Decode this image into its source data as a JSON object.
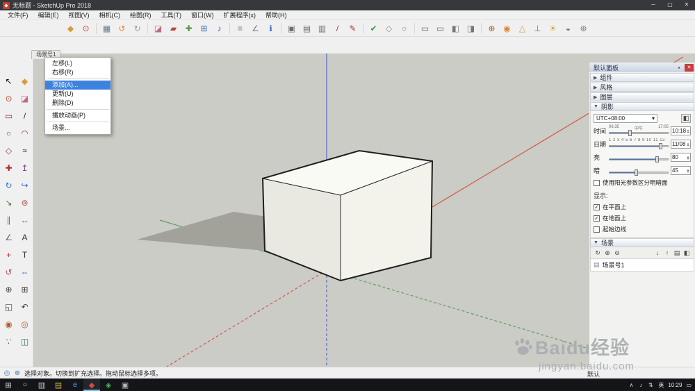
{
  "glyphs": {
    "logo": "◆",
    "minimize": "─",
    "maximize": "▢",
    "close": "✕",
    "pin": "▪",
    "panel_close": "✕",
    "caret_down": "▾",
    "spin_up": "▲",
    "spin_down": "▼",
    "check": "✓",
    "toggle_shadows": "◧"
  },
  "colors": {
    "accent": "#3e82e0",
    "axis_red": "#cf5a4c",
    "axis_green": "#5f9e5f",
    "axis_blue": "#5c64c8",
    "viewport_bg": "#cbccc5",
    "ground_shadow": "#a2a29a",
    "box_top": "#fafaf5",
    "box_left": "#e9e9e1",
    "box_right": "#f3f3ec",
    "edge": "#2a2a2a"
  },
  "title_bar": {
    "title": "无标题 - SketchUp Pro 2018"
  },
  "menu_bar": {
    "items": [
      {
        "name": "menu-file",
        "label": "文件(F)"
      },
      {
        "name": "menu-edit",
        "label": "编辑(E)"
      },
      {
        "name": "menu-view",
        "label": "视图(V)"
      },
      {
        "name": "menu-camera",
        "label": "相机(C)"
      },
      {
        "name": "menu-draw",
        "label": "绘图(R)"
      },
      {
        "name": "menu-tools",
        "label": "工具(T)"
      },
      {
        "name": "menu-window",
        "label": "窗口(W)"
      },
      {
        "name": "menu-extensions",
        "label": "扩展程序(x)"
      },
      {
        "name": "menu-help",
        "label": "帮助(H)"
      }
    ]
  },
  "main_toolbar": {
    "icons": [
      {
        "name": "make-component-icon",
        "glyph": "◆",
        "color": "#d89a3a"
      },
      {
        "name": "paint-bucket-icon",
        "glyph": "⊙",
        "color": "#bf4a35"
      },
      {
        "divider": true
      },
      {
        "name": "print-icon",
        "glyph": "▦",
        "color": "#6a7b8e"
      },
      {
        "name": "undo-icon",
        "glyph": "↺",
        "color": "#e0842f"
      },
      {
        "name": "redo-icon",
        "glyph": "↻",
        "color": "#9aa1a8"
      },
      {
        "divider": true
      },
      {
        "name": "eraser-icon",
        "glyph": "◪",
        "color": "#c06a88"
      },
      {
        "name": "paint-icon",
        "glyph": "▰",
        "color": "#b5483c"
      },
      {
        "name": "plant-component-icon",
        "glyph": "✚",
        "color": "#4f9a48"
      },
      {
        "name": "photo-texture-icon",
        "glyph": "⊞",
        "color": "#3c6fb3"
      },
      {
        "name": "audio-icon",
        "glyph": "♪",
        "color": "#2f6fd0"
      },
      {
        "divider": true
      },
      {
        "name": "tape-measure-icon",
        "glyph": "≡",
        "color": "#7d7d7d"
      },
      {
        "name": "dimension-icon",
        "glyph": "∠",
        "color": "#7d7d7d"
      },
      {
        "name": "model-info-icon",
        "glyph": "ℹ",
        "color": "#2f6fd0"
      },
      {
        "divider": true
      },
      {
        "name": "box-tool-icon-1",
        "glyph": "▣",
        "color": "#6e6e6e"
      },
      {
        "name": "box-tool-icon-2",
        "glyph": "▤",
        "color": "#6e6e6e"
      },
      {
        "name": "box-tool-icon-3",
        "glyph": "▥",
        "color": "#6e6e6e"
      },
      {
        "name": "slash-tool-icon",
        "glyph": "/",
        "color": "#b03434"
      },
      {
        "name": "pencil-tool-icon",
        "glyph": "✎",
        "color": "#b03434"
      },
      {
        "divider": true
      },
      {
        "name": "validate-check-icon",
        "glyph": "✔",
        "color": "#2f9e49"
      },
      {
        "name": "solid-tool-icon-1",
        "glyph": "◇",
        "color": "#8a8a8a"
      },
      {
        "name": "solid-tool-icon-2",
        "glyph": "○",
        "color": "#8a8a8a"
      },
      {
        "divider": true
      },
      {
        "name": "view-icon-1",
        "glyph": "▭",
        "color": "#5b6b7b"
      },
      {
        "name": "view-icon-2",
        "glyph": "▭",
        "color": "#5b6b7b"
      },
      {
        "name": "style-icon-1",
        "glyph": "◧",
        "color": "#777777"
      },
      {
        "name": "style-icon-2",
        "glyph": "◨",
        "color": "#777777"
      },
      {
        "divider": true
      },
      {
        "name": "position-camera-icon",
        "glyph": "⊕",
        "color": "#8a6a3a"
      },
      {
        "name": "look-around-icon",
        "glyph": "◉",
        "color": "#e0862f"
      },
      {
        "name": "set-square-icon",
        "glyph": "△",
        "color": "#d0a03c"
      },
      {
        "name": "walk-icon",
        "glyph": "⊥",
        "color": "#777777"
      },
      {
        "name": "sun-shadow-icon",
        "glyph": "☀",
        "color": "#e0a23c"
      },
      {
        "name": "section-plane-icon",
        "glyph": "◒",
        "color": "#777777"
      },
      {
        "name": "extras-icon",
        "glyph": "⊛",
        "color": "#777777"
      }
    ]
  },
  "sandbox_toolbar": {
    "icons": [
      {
        "name": "from-contours-icon",
        "glyph": "▲",
        "color": "#c8843c"
      },
      {
        "name": "from-scratch-icon",
        "glyph": "▦",
        "color": "#c8843c"
      },
      {
        "name": "smoove-icon",
        "glyph": "∩",
        "color": "#b06a3a"
      },
      {
        "name": "stamp-icon",
        "glyph": "▼",
        "color": "#b06a3a"
      },
      {
        "name": "drape-icon",
        "glyph": "▽",
        "color": "#b06a3a"
      },
      {
        "name": "add-detail-icon",
        "glyph": "△",
        "color": "#b06a3a"
      },
      {
        "name": "flip-edge-icon",
        "glyph": "⊿",
        "color": "#b06a3a"
      }
    ]
  },
  "left_toolbar": {
    "icons": [
      {
        "name": "select-tool-icon",
        "glyph": "↖",
        "color": "#111111"
      },
      {
        "name": "make-component-tool-icon",
        "glyph": "◆",
        "color": "#d89a3a"
      },
      {
        "name": "paint-tool-icon",
        "glyph": "⊙",
        "color": "#bf4a35"
      },
      {
        "name": "eraser-tool-icon",
        "glyph": "◪",
        "color": "#c06a88"
      },
      {
        "name": "rectangle-tool-icon",
        "glyph": "▭",
        "color": "#8a3a3a"
      },
      {
        "name": "line-tool-icon",
        "glyph": "/",
        "color": "#333333"
      },
      {
        "name": "circle-tool-icon",
        "glyph": "○",
        "color": "#8a3a3a"
      },
      {
        "name": "arc-tool-icon",
        "glyph": "◠",
        "color": "#8a3a3a"
      },
      {
        "name": "polygon-tool-icon",
        "glyph": "◇",
        "color": "#8a3a3a"
      },
      {
        "name": "freehand-tool-icon",
        "glyph": "≈",
        "color": "#333333"
      },
      {
        "name": "move-tool-icon",
        "glyph": "✚",
        "color": "#b03030"
      },
      {
        "name": "push-pull-tool-icon",
        "glyph": "↥",
        "color": "#7a4a9a"
      },
      {
        "name": "rotate-tool-icon",
        "glyph": "↻",
        "color": "#2f6fd0"
      },
      {
        "name": "follow-me-tool-icon",
        "glyph": "↪",
        "color": "#2f6fd0"
      },
      {
        "name": "scale-tool-icon",
        "glyph": "↘",
        "color": "#3a7a3a"
      },
      {
        "name": "offset-tool-icon",
        "glyph": "⊚",
        "color": "#b05050"
      },
      {
        "name": "tape-measure-tool-icon",
        "glyph": "∥",
        "color": "#666666"
      },
      {
        "name": "dimension-tool-icon",
        "glyph": "↔",
        "color": "#666666"
      },
      {
        "name": "protractor-tool-icon",
        "glyph": "∠",
        "color": "#666666"
      },
      {
        "name": "text-tool-icon",
        "glyph": "A",
        "color": "#333333"
      },
      {
        "name": "axes-tool-icon",
        "glyph": "+",
        "color": "#cc3333"
      },
      {
        "name": "3d-text-tool-icon",
        "glyph": "T",
        "color": "#333333"
      },
      {
        "name": "orbit-tool-icon",
        "glyph": "↺",
        "color": "#c04545"
      },
      {
        "name": "pan-tool-icon",
        "glyph": "⇔",
        "color": "#3a6fb0"
      },
      {
        "name": "zoom-tool-icon",
        "glyph": "⊕",
        "color": "#444444"
      },
      {
        "name": "zoom-window-tool-icon",
        "glyph": "⊞",
        "color": "#444444"
      },
      {
        "name": "zoom-extents-tool-icon",
        "glyph": "◱",
        "color": "#444444"
      },
      {
        "name": "previous-view-tool-icon",
        "glyph": "↶",
        "color": "#444444"
      },
      {
        "name": "position-camera-tool-icon",
        "glyph": "◉",
        "color": "#b05a2a"
      },
      {
        "name": "look-around-tool-icon",
        "glyph": "◎",
        "color": "#b05a2a"
      },
      {
        "name": "walk-tool-icon",
        "glyph": "∵",
        "color": "#555555"
      },
      {
        "name": "section-plane-tool-icon",
        "glyph": "◫",
        "color": "#2f7d4f"
      }
    ]
  },
  "scene_tab": {
    "label": "场景号1"
  },
  "context_menu": {
    "items": [
      {
        "name": "menu-item-move-left",
        "label": "左移(L)"
      },
      {
        "name": "menu-item-move-right",
        "label": "右移(R)"
      },
      {
        "separator": true
      },
      {
        "name": "menu-item-add",
        "label": "添加(A)...",
        "highlighted": true
      },
      {
        "name": "menu-item-update",
        "label": "更新(U)"
      },
      {
        "name": "menu-item-delete",
        "label": "删除(D)"
      },
      {
        "separator": true
      },
      {
        "name": "menu-item-play-animation",
        "label": "播放动画(P)"
      },
      {
        "separator": true
      },
      {
        "name": "menu-item-scenes",
        "label": "场景..."
      }
    ]
  },
  "right_panel": {
    "title": "默认面板",
    "sections": [
      {
        "label": "组件",
        "caret": "▶"
      },
      {
        "label": "风格",
        "caret": "▶"
      },
      {
        "label": "图层",
        "caret": "▶"
      },
      {
        "label": "阴影",
        "caret": "▼"
      }
    ],
    "shadows": {
      "timezone": "UTC+08:00",
      "time_label": "时间",
      "time_value": "10:18",
      "time_ticks": {
        "left": "06:35",
        "mid": "中午",
        "right": "17:05"
      },
      "date_label": "日期",
      "date_value": "11/08",
      "date_ticks": "1 2 3 4 5 6 7 8 9 10 11 12",
      "light_label": "亮",
      "light_value": "80",
      "dark_label": "暗",
      "dark_value": "45",
      "use_sun_label": "使用阳光参数区分明暗面",
      "display_label": "显示:",
      "on_faces_label": "在平面上",
      "on_ground_label": "在地面上",
      "from_edges_label": "起始边线"
    },
    "scenes": {
      "label": "场景",
      "caret": "▼",
      "left_icons": [
        {
          "name": "scene-update-icon",
          "glyph": "↻"
        },
        {
          "name": "scene-add-icon",
          "glyph": "⊕"
        },
        {
          "name": "scene-remove-icon",
          "glyph": "⊖"
        }
      ],
      "right_icons": [
        {
          "name": "scene-move-down-icon",
          "glyph": "↓"
        },
        {
          "name": "scene-move-up-icon",
          "glyph": "↑"
        },
        {
          "name": "scene-details-icon",
          "glyph": "▤"
        },
        {
          "name": "scene-options-icon",
          "glyph": "◧"
        }
      ],
      "item_label": "场景号1"
    }
  },
  "status_bar": {
    "icons": [
      {
        "name": "geolocation-icon",
        "glyph": "◎",
        "color": "#3a78c3"
      },
      {
        "name": "claim-credit-icon",
        "glyph": "⊕",
        "color": "#3a78c3"
      }
    ],
    "message": "选择对象。切换到扩充选择。拖动鼠标选择多项。",
    "tray_label": "默认"
  },
  "taskbar": {
    "icons": [
      {
        "name": "start-button",
        "glyph": "⊞",
        "color": "#e8e8e8"
      },
      {
        "name": "search-icon",
        "glyph": "○",
        "color": "#cfcfcf"
      },
      {
        "name": "task-view-button",
        "glyph": "▥",
        "color": "#cfcfcf"
      },
      {
        "name": "file-explorer-button",
        "glyph": "▤",
        "color": "#d8b23c"
      },
      {
        "name": "edge-browser-button",
        "glyph": "e",
        "color": "#4c9ce0"
      },
      {
        "name": "sketchup-taskbar-button",
        "glyph": "◆",
        "color": "#d84a38",
        "active": true
      },
      {
        "name": "app-button-1",
        "glyph": "◈",
        "color": "#58b058"
      },
      {
        "name": "app-button-2",
        "glyph": "▣",
        "color": "#b8b8b8"
      }
    ],
    "tray_icons": [
      {
        "name": "hidden-icons-expand-icon",
        "glyph": "∧"
      },
      {
        "name": "volume-icon",
        "glyph": "♪"
      },
      {
        "name": "network-icon",
        "glyph": "⇅"
      }
    ],
    "ime": "英",
    "time": "10:29",
    "notification_glyph": "▭"
  },
  "watermark": {
    "brand": "Baidu",
    "brand_cn": "经验",
    "url": "jingyan.baidu.com"
  }
}
